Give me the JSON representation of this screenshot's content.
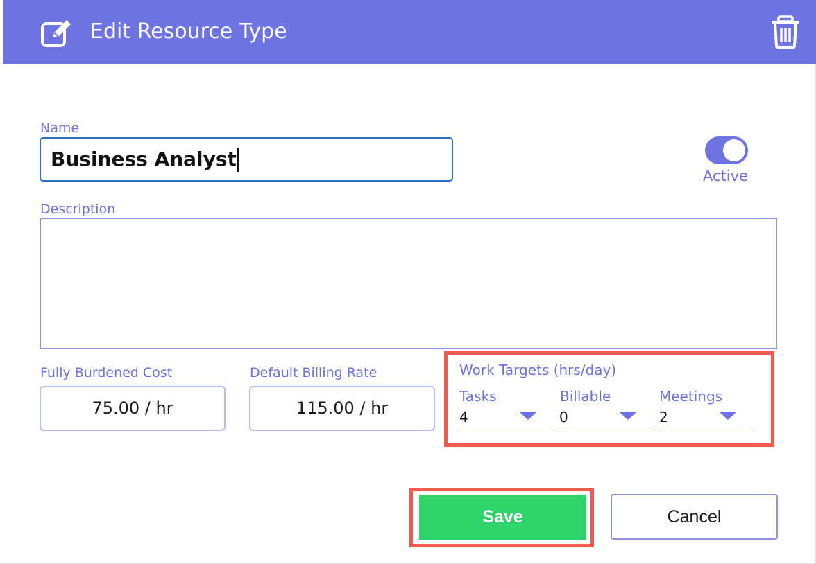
{
  "dialog": {
    "title": "Edit Resource Type",
    "header_color": "#6d73e0",
    "accent_color": "#6d73e0",
    "highlight_color": "#f05a4f",
    "save_color": "#2ed36a"
  },
  "form": {
    "name_label": "Name",
    "name_value": "Business Analyst",
    "active_label": "Active",
    "active": true,
    "description_label": "Description",
    "description_value": "",
    "cost_label": "Fully Burdened Cost",
    "cost_value": "75.00 / hr",
    "billing_label": "Default Billing Rate",
    "billing_value": "115.00 / hr",
    "work_targets": {
      "title": "Work Targets (hrs/day)",
      "items": [
        {
          "label": "Tasks",
          "value": "4"
        },
        {
          "label": "Billable",
          "value": "0"
        },
        {
          "label": "Meetings",
          "value": "2"
        }
      ]
    }
  },
  "actions": {
    "save_label": "Save",
    "cancel_label": "Cancel"
  },
  "icons": {
    "header_icon": "edit-icon",
    "delete_icon": "trash-icon"
  }
}
